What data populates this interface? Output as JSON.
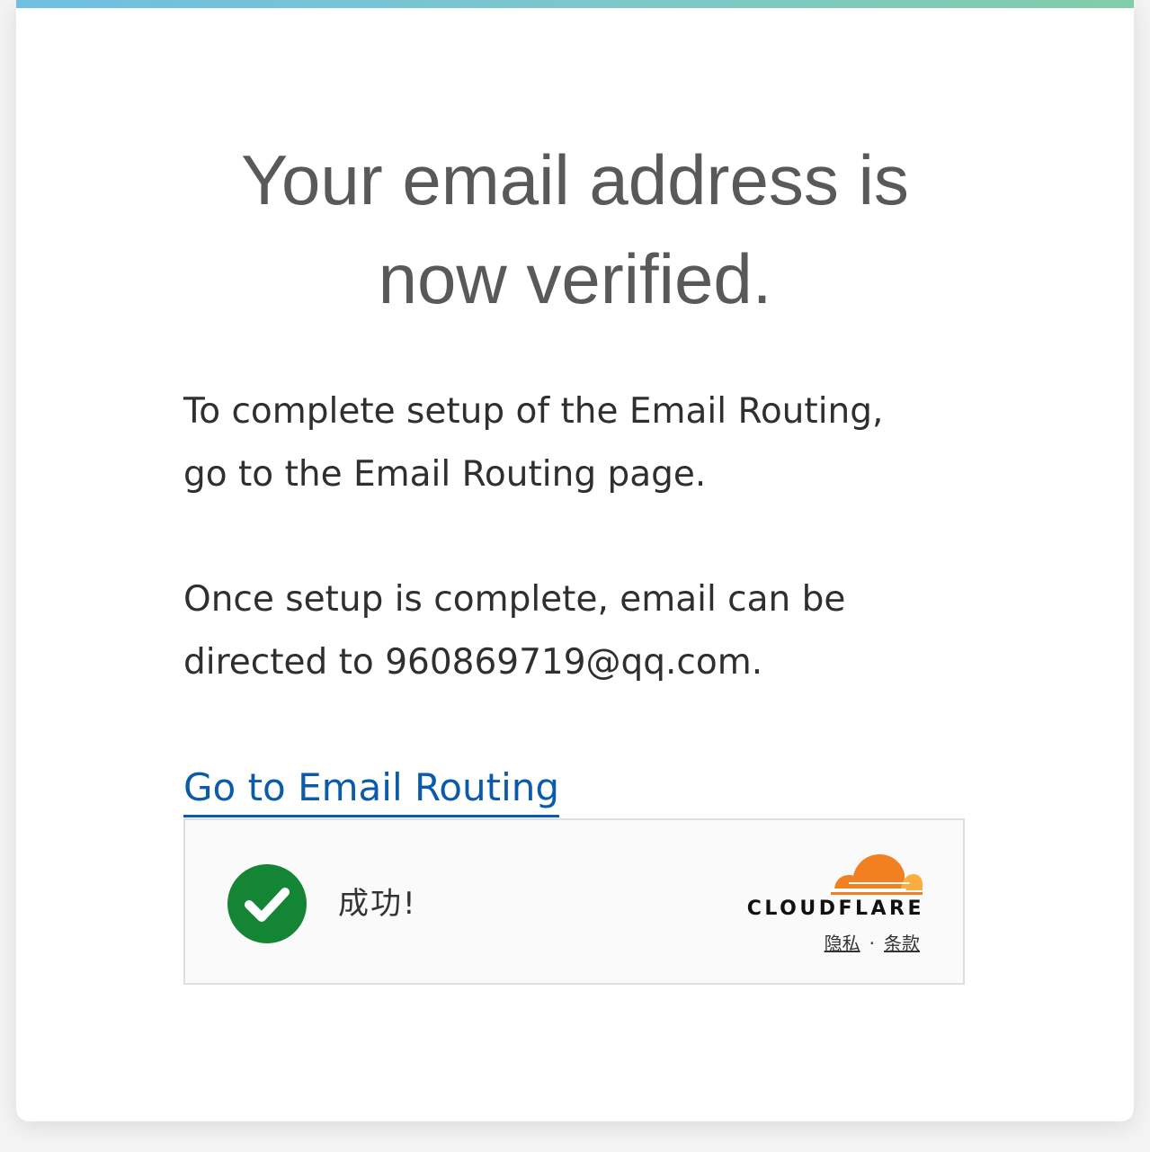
{
  "page": {
    "title_lines": [
      "Your email address is",
      "now verified."
    ],
    "paragraph1_lines": [
      "To complete setup of the Email Routing,",
      "go to the Email Routing page."
    ],
    "paragraph2_lines": [
      "Once setup is complete, email can be",
      "directed to 960869719@qq.com."
    ],
    "link_label": "Go to Email Routing"
  },
  "widget": {
    "status_text": "成功!",
    "status_icon": "check-circle-icon",
    "brand_name": "CLOUDFLARE",
    "brand_logo": "cloudflare-cloud-icon",
    "privacy_label": "隐私",
    "separator": "·",
    "terms_label": "条款"
  },
  "colors": {
    "top_bar_gradient": [
      "#6fbfe2",
      "#82cda9"
    ],
    "link": "#0c5bab",
    "success": "#138535",
    "brand_orange": "#f38020",
    "brand_light_orange": "#fbad41"
  }
}
